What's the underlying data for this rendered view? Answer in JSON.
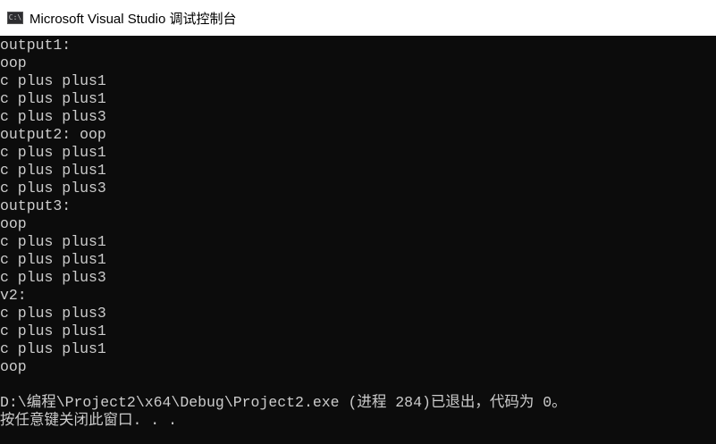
{
  "window": {
    "icon_label": "C:\\",
    "title": "Microsoft Visual Studio 调试控制台"
  },
  "console": {
    "lines": [
      "output1:",
      "oop",
      "c plus plus1",
      "c plus plus1",
      "c plus plus3",
      "output2: oop",
      "c plus plus1",
      "c plus plus1",
      "c plus plus3",
      "output3:",
      "oop",
      "c plus plus1",
      "c plus plus1",
      "c plus plus3",
      "v2:",
      "c plus plus3",
      "c plus plus1",
      "c plus plus1",
      "oop",
      "",
      "D:\\编程\\Project2\\x64\\Debug\\Project2.exe (进程 284)已退出，代码为 0。",
      "按任意键关闭此窗口. . ."
    ]
  },
  "colors": {
    "console_bg": "#0c0c0c",
    "console_fg": "#cccccc",
    "titlebar_bg": "#ffffff"
  }
}
